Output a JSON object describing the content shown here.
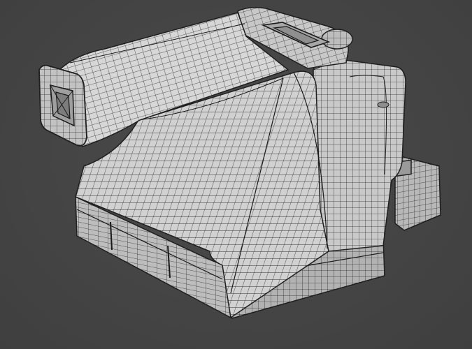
{
  "scene": {
    "subject": "camera-wireframe-model",
    "colors": {
      "background": "#454545",
      "surface_light": "#dadada",
      "surface_mid": "#c4c4c4",
      "surface_dark": "#a9a9a9",
      "wire": "#2a2a2a"
    }
  }
}
